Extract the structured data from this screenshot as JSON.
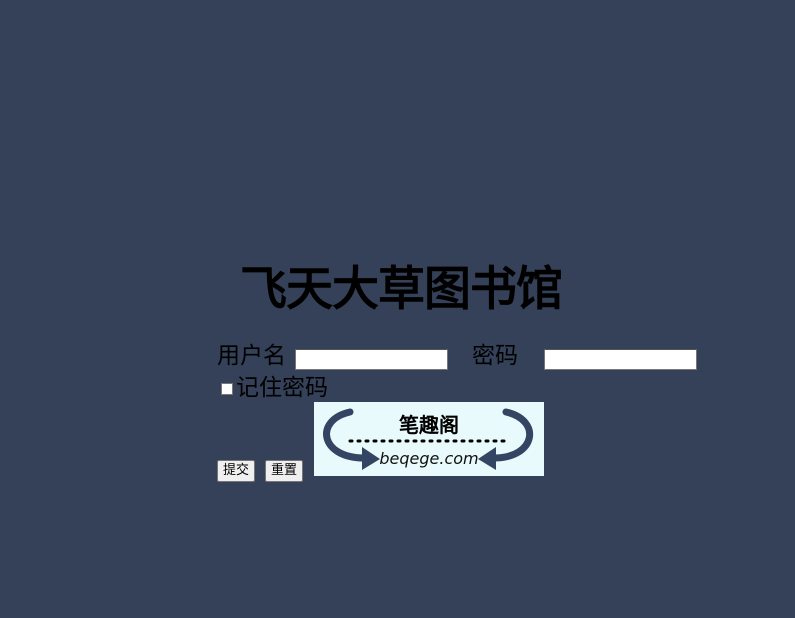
{
  "title": "飞天大草图书馆",
  "form": {
    "username_label": "用户名",
    "username_value": "",
    "password_label": "密码",
    "password_value": "",
    "remember_label": "记住密码",
    "remember_checked": false,
    "submit_label": "提交",
    "reset_label": "重置"
  },
  "logo": {
    "chinese": "笔趣阁",
    "domain": "beqege.com",
    "arrow_color": "#344463"
  },
  "colors": {
    "background": "#344158"
  }
}
